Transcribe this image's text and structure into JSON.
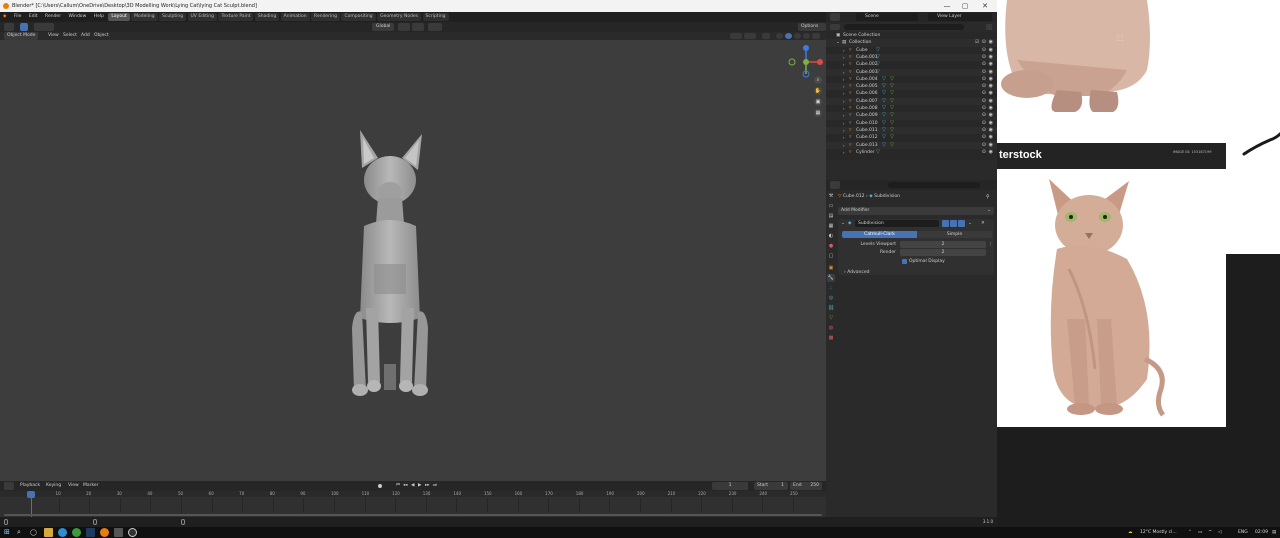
{
  "window": {
    "title": "Blender* [C:\\Users\\Callum\\OneDrive\\Desktop\\3D Modelling Work\\Lying Cat\\lying Cat Sculpt.blend]",
    "minimize": "—",
    "maximize": "▢",
    "close": "✕"
  },
  "menus": [
    "File",
    "Edit",
    "Render",
    "Window",
    "Help"
  ],
  "workspaces": [
    {
      "label": "Layout",
      "active": true
    },
    {
      "label": "Modeling"
    },
    {
      "label": "Sculpting"
    },
    {
      "label": "UV Editing"
    },
    {
      "label": "Texture Paint"
    },
    {
      "label": "Shading"
    },
    {
      "label": "Animation"
    },
    {
      "label": "Rendering"
    },
    {
      "label": "Compositing"
    },
    {
      "label": "Geometry Nodes"
    },
    {
      "label": "Scripting"
    }
  ],
  "viewport": {
    "transform_orientation": "Global",
    "options_label": "Options ⌄",
    "mode": "Object Mode",
    "menu": [
      "View",
      "Select",
      "Add",
      "Object"
    ]
  },
  "scene": {
    "scene_label": "Scene",
    "view_layer_label": "View Layer"
  },
  "outliner": {
    "root": "Scene Collection",
    "collection": "Collection",
    "objects": [
      "Cube",
      "Cube.001",
      "Cube.002",
      "Cube.003",
      "Cube.004",
      "Cube.005",
      "Cube.006",
      "Cube.007",
      "Cube.008",
      "Cube.009",
      "Cube.010",
      "Cube.011",
      "Cube.012",
      "Cube.013",
      "Cylinder"
    ]
  },
  "properties": {
    "object_name": "Cube.012",
    "modifier_chip": "Subdivision",
    "add_modifier": "Add Modifier",
    "modifier_name": "Subdivision",
    "tab_catmull": "Catmull-Clark",
    "tab_simple": "Simple",
    "levels_viewport_label": "Levels Viewport",
    "levels_viewport_value": "2",
    "render_label": "Render",
    "render_value": "2",
    "optimal_display": "Optimal Display",
    "advanced": "Advanced"
  },
  "timeline": {
    "menus": [
      "Playback",
      "Keying",
      "View",
      "Marker"
    ],
    "current_frame": "1",
    "start_label": "Start",
    "start_value": "1",
    "end_label": "End",
    "end_value": "250",
    "ticks": [
      "1",
      "10",
      "20",
      "30",
      "40",
      "50",
      "60",
      "70",
      "80",
      "90",
      "100",
      "110",
      "120",
      "130",
      "140",
      "150",
      "160",
      "170",
      "180",
      "190",
      "200",
      "210",
      "220",
      "230",
      "240",
      "250"
    ]
  },
  "status": {
    "version": "3.1.0"
  },
  "reference": {
    "watermark": "shutterstock",
    "watermark_visible": "terstock",
    "image_id": "IMAGE ID: 153187199"
  },
  "taskbar": {
    "weather": "12°C  Mostly cl...",
    "lang": "ENG",
    "time": "02:09"
  },
  "colors": {
    "accent_blue": "#4772b3",
    "object_orange": "#e08f2b",
    "modifier_teal": "#4bb3c5",
    "axis_x": "#e04848",
    "axis_y": "#7ab23c",
    "axis_z": "#3d7ce0"
  }
}
